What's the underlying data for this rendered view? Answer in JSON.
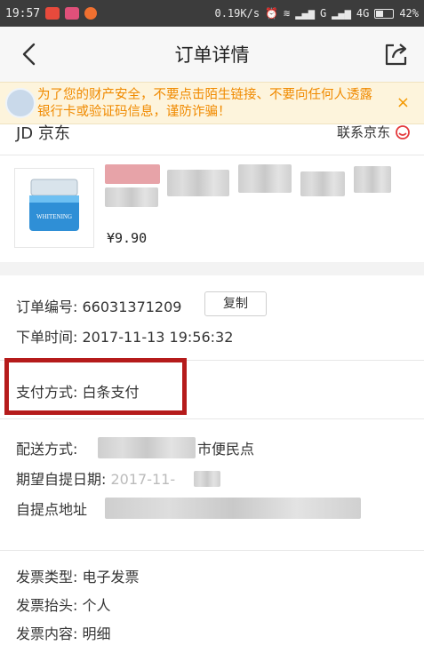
{
  "status_bar": {
    "time": "19:57",
    "network_speed": "0.19K/s",
    "signal_text": "G",
    "network_type": "4G",
    "battery": "42%",
    "battery_level": 0.42
  },
  "nav": {
    "title": "订单详情",
    "back_icon": "chevron-left-icon",
    "share_icon": "share-icon"
  },
  "warning": {
    "text": "为了您的财产安全，不要点击陌生链接、不要向任何人透露银行卡或验证码信息，谨防诈骗！",
    "close": "×"
  },
  "shop": {
    "name": "JD 京东",
    "contact": "联系京东"
  },
  "product": {
    "price": "¥9.90",
    "thumb_text": "WHITENING"
  },
  "order": {
    "number_label": "订单编号: ",
    "number": "66031371209",
    "copy_label": "复制",
    "time_label": "下单时间: ",
    "time": "2017-11-13 19:56:32"
  },
  "payment": {
    "label": "支付方式: ",
    "value": "白条支付"
  },
  "delivery": {
    "method_label": "配送方式: ",
    "method_suffix": "市便民点",
    "date_label": "期望自提日期: ",
    "date_partial": "2017-11-",
    "address_label": "自提点地址"
  },
  "invoice": {
    "type_label": "发票类型: ",
    "type": "电子发票",
    "title_label": "发票抬头: ",
    "title": "个人",
    "content_label": "发票内容: ",
    "content": "明细"
  },
  "colors": {
    "warning_text": "#f08a00",
    "highlight": "#b51b1b"
  }
}
